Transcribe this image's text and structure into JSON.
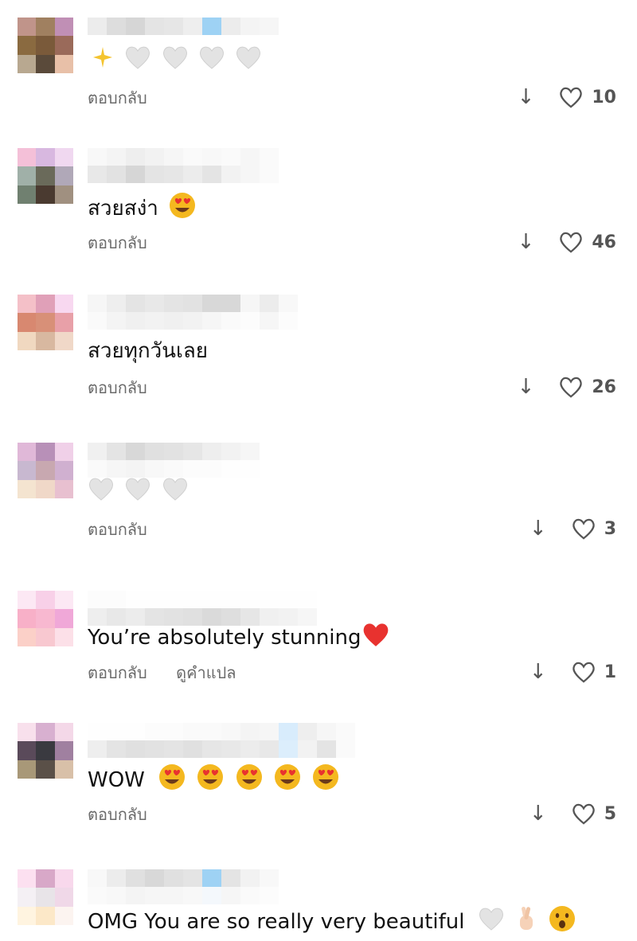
{
  "labels": {
    "reply": "ตอบกลับ",
    "see_translation": "ดูคำแปล"
  },
  "icons": {
    "down": "down-arrow-icon",
    "like": "heart-outline-icon"
  },
  "comments": [
    {
      "text": "",
      "likes": "10",
      "emojis": [
        "sparkles",
        "white-heart",
        "white-heart",
        "white-heart",
        "white-heart"
      ]
    },
    {
      "text": "สวยสง่า",
      "likes": "46",
      "emojis": [
        "heart-eyes"
      ]
    },
    {
      "text": "สวยทุกวันเลย",
      "likes": "26",
      "emojis": []
    },
    {
      "text": "",
      "likes": "3",
      "emojis": [
        "white-heart",
        "white-heart",
        "white-heart"
      ]
    },
    {
      "text": "You’re absolutely stunning",
      "likes": "1",
      "emojis": [
        "red-heart"
      ],
      "show_translate": true
    },
    {
      "text": "WOW",
      "likes": "5",
      "emojis": [
        "heart-eyes",
        "heart-eyes",
        "heart-eyes",
        "heart-eyes",
        "heart-eyes"
      ]
    },
    {
      "text": "OMG You are so really very beautiful",
      "likes": "",
      "emojis": [
        "white-heart",
        "crossed-fingers",
        "astonished-face"
      ]
    }
  ],
  "colors": {
    "muted": "#6b6b6b",
    "heart_red": "#e8322f",
    "white_heart": "#d6d6d6",
    "emoji_yellow": "#f4b81f"
  }
}
